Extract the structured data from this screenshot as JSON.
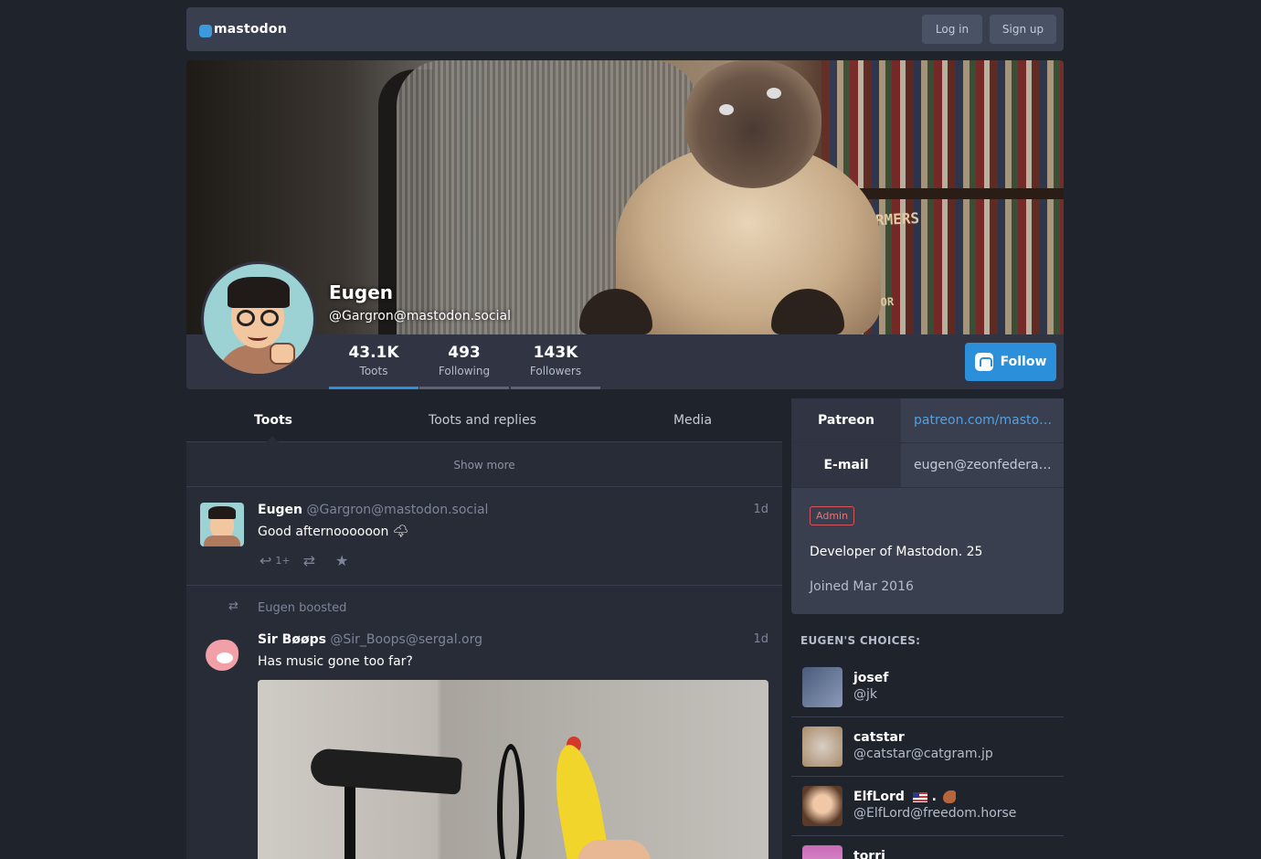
{
  "topbar": {
    "logo_text": "mastodon",
    "login_label": "Log in",
    "signup_label": "Sign up"
  },
  "profile": {
    "display_name": "Eugen",
    "acct": "@Gargron@mastodon.social",
    "follow_label": "Follow",
    "stats": [
      {
        "value": "43.1K",
        "label": "Toots"
      },
      {
        "value": "493",
        "label": "Following"
      },
      {
        "value": "143K",
        "label": "Followers"
      }
    ],
    "sign_text": "SFORMERS",
    "sign_text2": "EATOR"
  },
  "tabs": [
    "Toots",
    "Toots and replies",
    "Media"
  ],
  "timeline": {
    "show_more": "Show more",
    "statuses": [
      {
        "name": "Eugen",
        "acct": "@Gargron@mastodon.social",
        "time": "1d",
        "content": "Good afternoooooon 🌩",
        "reply_count": "1+"
      },
      {
        "boosted_by": "Eugen boosted",
        "name": "Sir Bøøps",
        "acct": "@Sir_Boops@sergal.org",
        "time": "1d",
        "content": "Has music gone too far?"
      }
    ]
  },
  "sidebar": {
    "fields": [
      {
        "key": "Patreon",
        "value": "patreon.com/mastodon"
      },
      {
        "key": "E-mail",
        "value": "eugen@zeonfederated…"
      }
    ],
    "badge": "Admin",
    "bio": "Developer of Mastodon. 25",
    "joined": "Joined Mar 2016",
    "choices_heading": "EUGEN'S CHOICES:",
    "choices": [
      {
        "name": "josef",
        "acct": "@jk",
        "color": "#6a7a9a"
      },
      {
        "name": "catstar",
        "acct": "@catstar@catgram.jp",
        "color": "#b08a6a"
      },
      {
        "name": "ElfLord",
        "name_suffix": ".",
        "acct": "@ElfLord@freedom.horse",
        "color": "#d8b898"
      },
      {
        "name": "torri",
        "acct": "",
        "color": "#c86ab8"
      }
    ]
  },
  "colors": {
    "accent": "#2b90d9",
    "background": "#1f232b",
    "panel": "#282c37",
    "admin_badge": "#d4555a"
  }
}
